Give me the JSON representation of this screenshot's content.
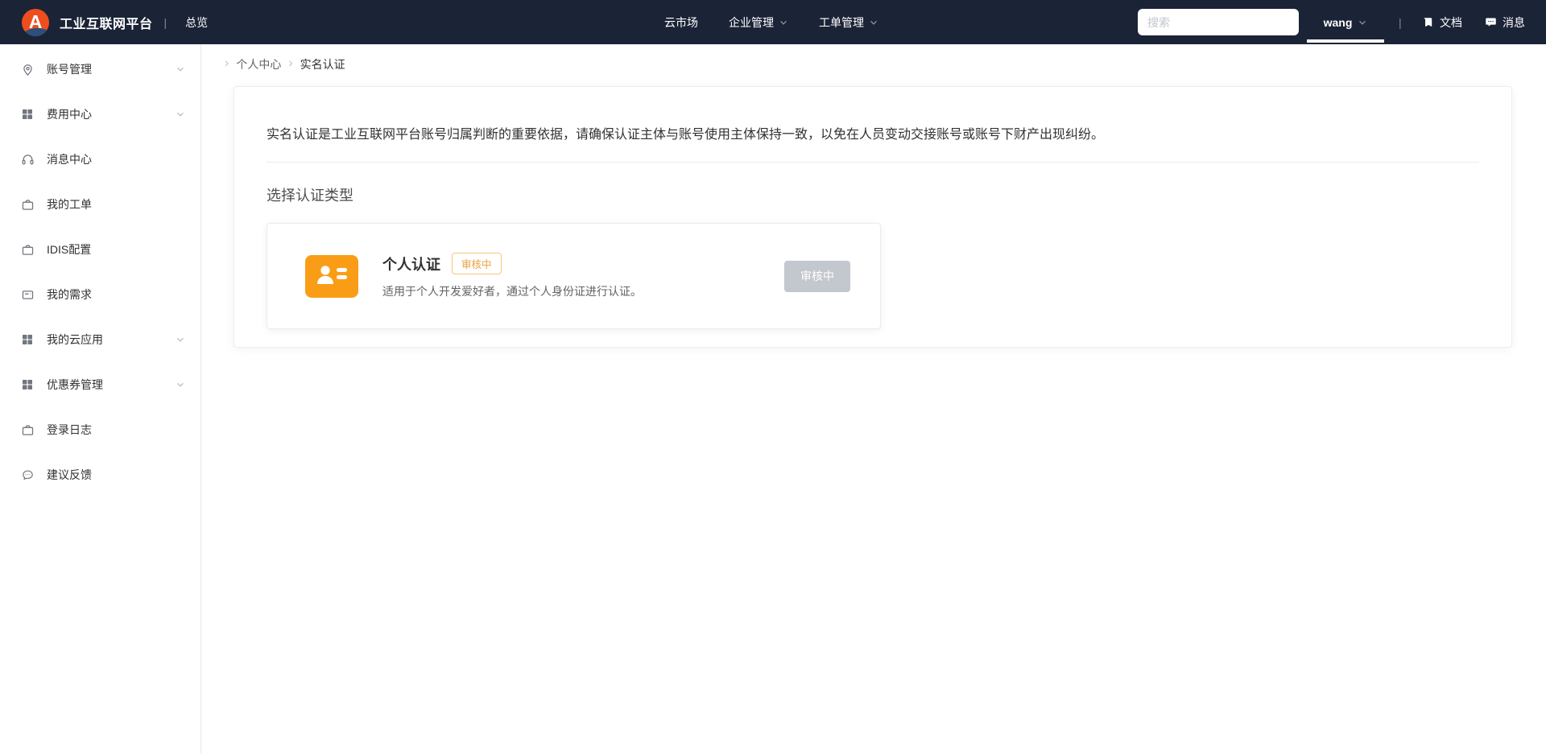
{
  "colors": {
    "navbar_bg": "#1b2337",
    "logo_orange": "#ee4e1e",
    "logo_blue": "#2c4f7c",
    "accent_orange": "#fa9d16",
    "badge_orange": "#e8a23d",
    "disabled_gray": "#c3c7ce"
  },
  "navbar": {
    "logo_letter": "A",
    "brand": "工业互联网平台",
    "divider": "|",
    "overview": "总览",
    "menu": [
      {
        "name": "cloud-market",
        "label": "云市场",
        "has_dropdown": false
      },
      {
        "name": "enterprise-management",
        "label": "企业管理",
        "has_dropdown": true
      },
      {
        "name": "ticket-management",
        "label": "工单管理",
        "has_dropdown": true
      }
    ],
    "search_placeholder": "搜索",
    "user": {
      "label": "wang",
      "has_dropdown": true
    },
    "divider2": "|",
    "links": [
      {
        "name": "docs",
        "label": "文档",
        "icon": "book-icon"
      },
      {
        "name": "messages",
        "label": "消息",
        "icon": "message-icon"
      }
    ]
  },
  "sidebar": {
    "items": [
      {
        "name": "account-management",
        "label": "账号管理",
        "icon": "location-pin-icon",
        "expandable": true
      },
      {
        "name": "billing-center",
        "label": "费用中心",
        "icon": "grid-icon",
        "expandable": true
      },
      {
        "name": "message-center",
        "label": "消息中心",
        "icon": "headset-icon",
        "expandable": false
      },
      {
        "name": "my-tickets",
        "label": "我的工单",
        "icon": "briefcase-icon",
        "expandable": false
      },
      {
        "name": "idis-config",
        "label": "IDIS配置",
        "icon": "briefcase-icon",
        "expandable": false
      },
      {
        "name": "my-requirements",
        "label": "我的需求",
        "icon": "card-icon",
        "expandable": false
      },
      {
        "name": "my-cloud-apps",
        "label": "我的云应用",
        "icon": "grid-icon",
        "expandable": true
      },
      {
        "name": "coupon-management",
        "label": "优惠券管理",
        "icon": "grid-icon",
        "expandable": true
      },
      {
        "name": "login-logs",
        "label": "登录日志",
        "icon": "briefcase-icon",
        "expandable": false
      },
      {
        "name": "feedback",
        "label": "建议反馈",
        "icon": "feedback-icon",
        "expandable": false
      }
    ]
  },
  "breadcrumb": {
    "separator": "›",
    "items": [
      {
        "label": "个人中心",
        "current": false
      },
      {
        "label": "实名认证",
        "current": true
      }
    ]
  },
  "main": {
    "intro": "实名认证是工业互联网平台账号归属判断的重要依据，请确保认证主体与账号使用主体保持一致，以免在人员变动交接账号或账号下财产出现纠纷。",
    "section_title": "选择认证类型",
    "auth_card": {
      "title": "个人认证",
      "badge": "审核中",
      "description": "适用于个人开发爱好者，通过个人身份证进行认证。",
      "button_label": "审核中",
      "icon": "id-card-icon"
    }
  }
}
